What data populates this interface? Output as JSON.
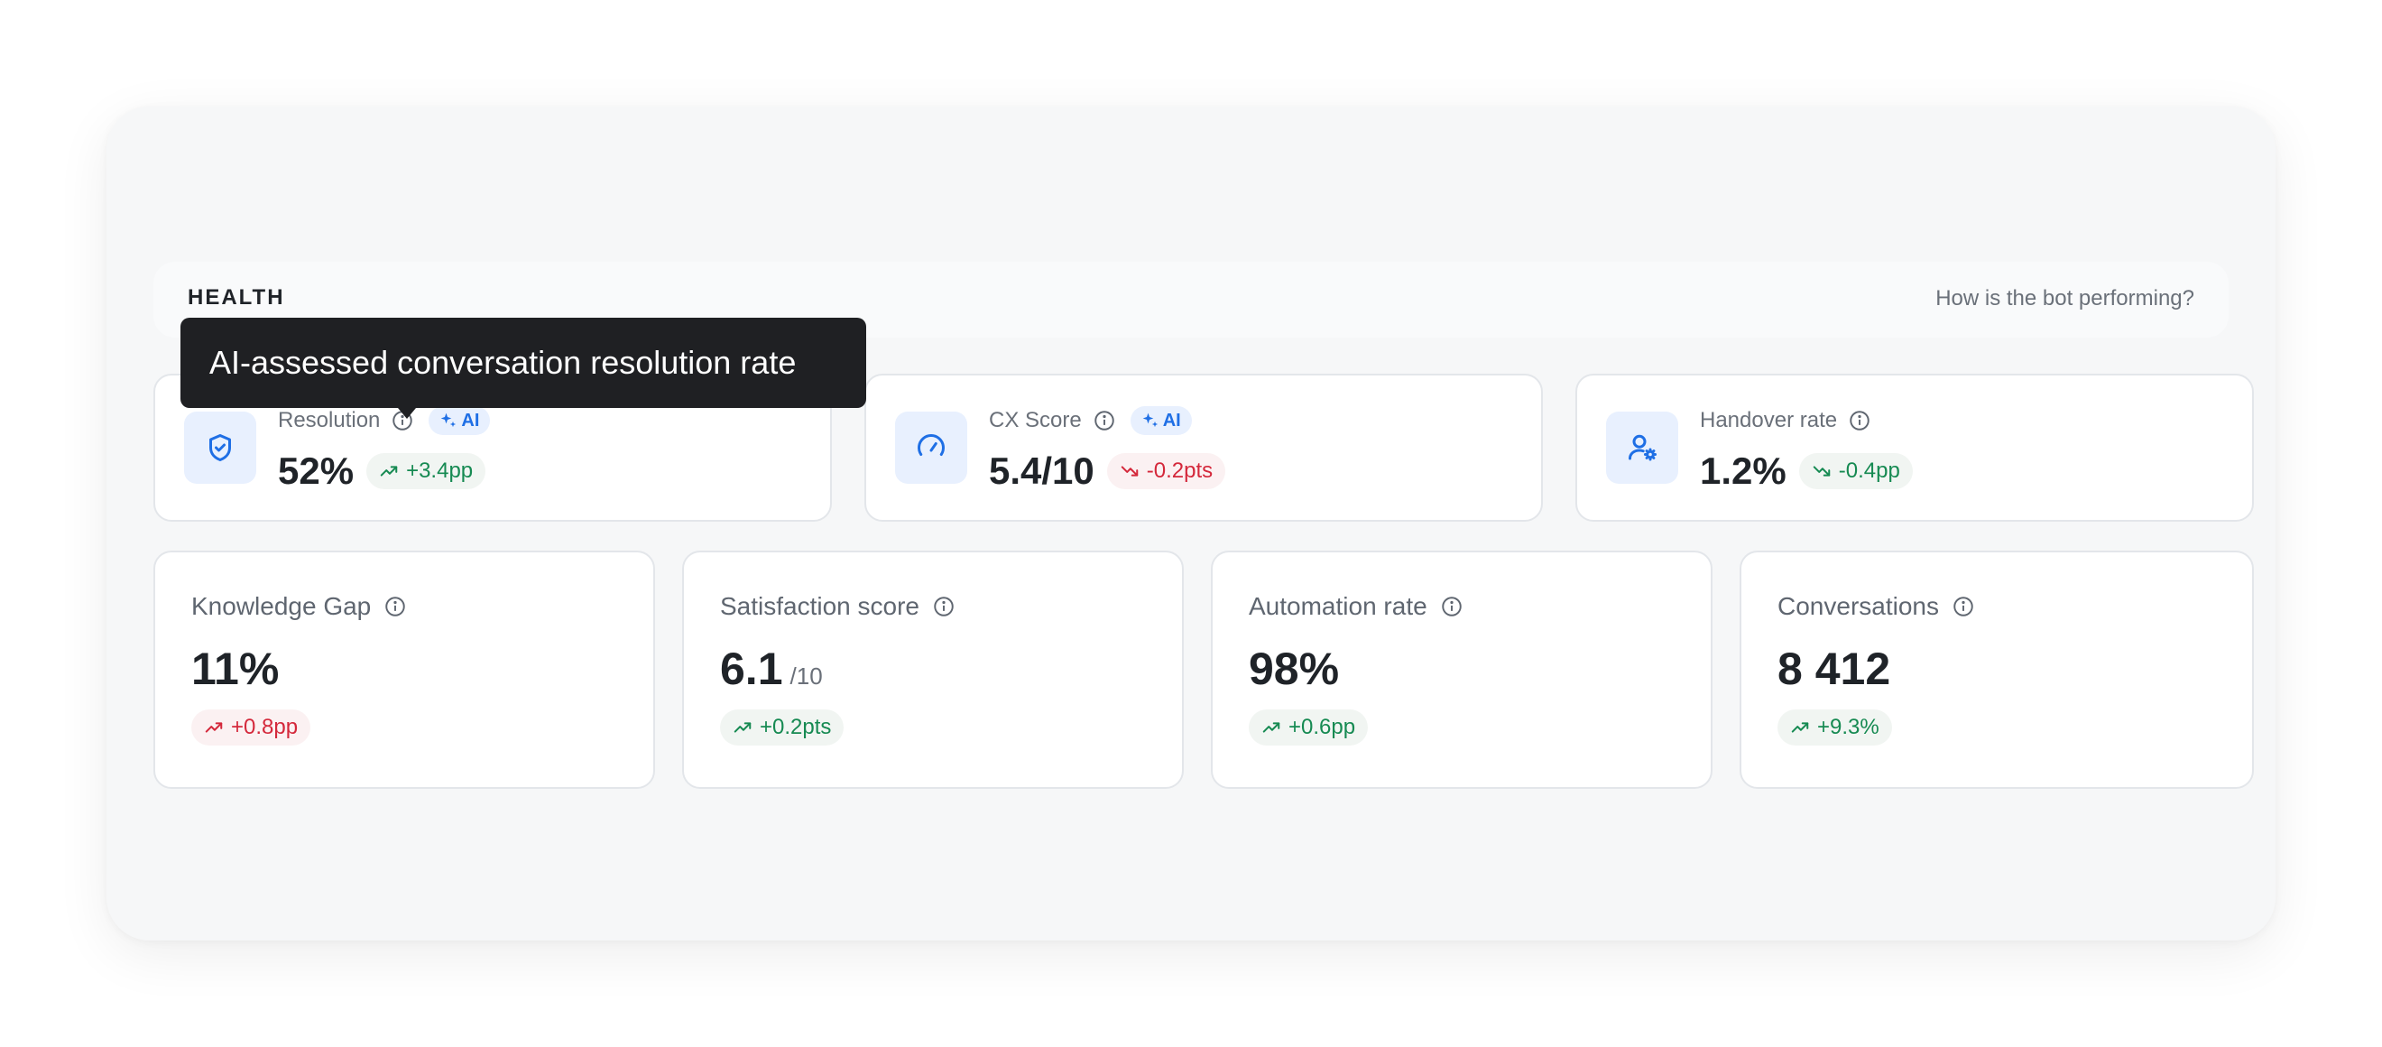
{
  "section": {
    "title": "HEALTH",
    "subtitle": "How is the bot performing?"
  },
  "tooltip": {
    "text": "AI-assessed conversation resolution rate"
  },
  "top_cards": [
    {
      "label": "Resolution",
      "icon": "shield-check-icon",
      "ai_badge": "AI",
      "value": "52%",
      "delta": "+3.4pp",
      "delta_trend": "up",
      "delta_status": "good"
    },
    {
      "label": "CX Score",
      "icon": "speedometer-icon",
      "ai_badge": "AI",
      "value": "5.4/10",
      "delta": "-0.2pts",
      "delta_trend": "down",
      "delta_status": "bad"
    },
    {
      "label": "Handover rate",
      "icon": "user-gear-icon",
      "value": "1.2%",
      "delta": "-0.4pp",
      "delta_trend": "down",
      "delta_status": "good"
    }
  ],
  "bottom_cards": [
    {
      "label": "Knowledge Gap",
      "value": "11%",
      "suffix": "",
      "delta": "+0.8pp",
      "delta_trend": "up",
      "delta_status": "bad"
    },
    {
      "label": "Satisfaction score",
      "value": "6.1",
      "suffix": "/10",
      "delta": "+0.2pts",
      "delta_trend": "up",
      "delta_status": "good"
    },
    {
      "label": "Automation rate",
      "value": "98%",
      "suffix": "",
      "delta": "+0.6pp",
      "delta_trend": "up",
      "delta_status": "good"
    },
    {
      "label": "Conversations",
      "value": "8 412",
      "suffix": "",
      "delta": "+9.3%",
      "delta_trend": "up",
      "delta_status": "good"
    }
  ],
  "colors": {
    "accent": "#1f6fe5",
    "good": "#168a52",
    "bad": "#d4283b"
  }
}
